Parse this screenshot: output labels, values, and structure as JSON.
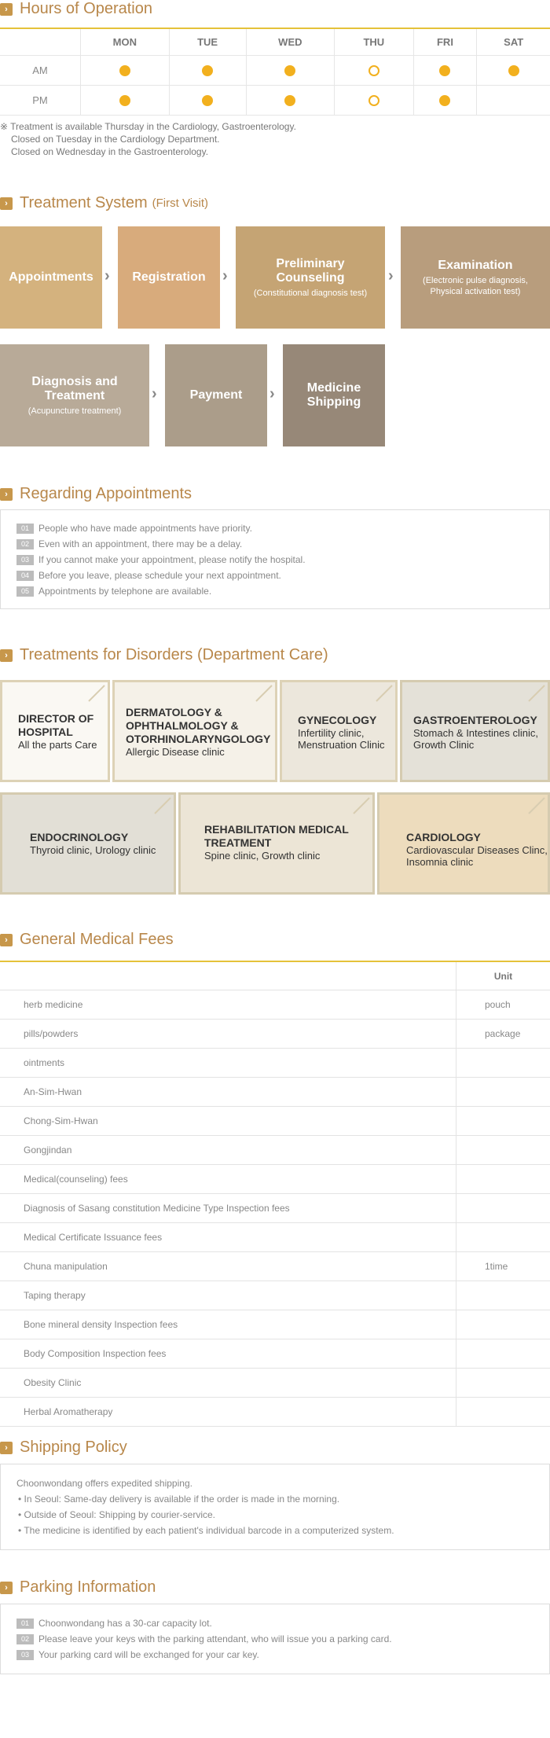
{
  "hours": {
    "title": "Hours of Operation",
    "days": [
      "MON",
      "TUE",
      "WED",
      "THU",
      "FRI",
      "SAT"
    ],
    "rows": [
      {
        "label": "AM",
        "cells": [
          "filled",
          "filled",
          "filled",
          "open",
          "filled",
          "filled"
        ]
      },
      {
        "label": "PM",
        "cells": [
          "filled",
          "filled",
          "filled",
          "open",
          "filled",
          "none"
        ]
      }
    ],
    "notes": [
      "※ Treatment is available Thursday in the Cardiology, Gastroenterology.",
      "Closed on Tuesday in the Cardiology Department.",
      "Closed on Wednesday in the Gastroenterology."
    ]
  },
  "treatment_system": {
    "title": "Treatment System",
    "subtitle": "(First Visit)",
    "steps": [
      {
        "title": "Appointments",
        "sub": ""
      },
      {
        "title": "Registration",
        "sub": ""
      },
      {
        "title": "Preliminary Counseling",
        "sub": "(Constitutional diagnosis test)"
      },
      {
        "title": "Examination",
        "sub": "(Electronic pulse diagnosis, Physical activation test)"
      },
      {
        "title": "Diagnosis and Treatment",
        "sub": "(Acupuncture treatment)"
      },
      {
        "title": "Payment",
        "sub": ""
      },
      {
        "title": "Medicine Shipping",
        "sub": ""
      }
    ]
  },
  "appointments": {
    "title": "Regarding Appointments",
    "items": [
      {
        "num": "01",
        "text": "People who have made appointments have priority."
      },
      {
        "num": "02",
        "text": "Even with an appointment, there may be a delay."
      },
      {
        "num": "03",
        "text": "If you cannot make your appointment, please notify the hospital."
      },
      {
        "num": "04",
        "text": "Before you leave, please schedule your next appointment."
      },
      {
        "num": "05",
        "text": "Appointments by telephone are available."
      }
    ]
  },
  "disorders": {
    "title": "Treatments for Disorders (Department Care)",
    "departments": [
      {
        "name": "DIRECTOR OF HOSPITAL",
        "desc": "All the parts Care"
      },
      {
        "name": "DERMATOLOGY & OPHTHALMOLOGY & OTORHINOLARYNGOLOGY",
        "desc": "Allergic Disease clinic"
      },
      {
        "name": "GYNECOLOGY",
        "desc": "Infertility clinic, Menstruation Clinic"
      },
      {
        "name": "GASTROENTEROLOGY",
        "desc": "Stomach & Intestines clinic, Growth Clinic"
      },
      {
        "name": "ENDOCRINOLOGY",
        "desc": "Thyroid clinic, Urology clinic"
      },
      {
        "name": "REHABILITATION MEDICAL TREATMENT",
        "desc": "Spine clinic, Growth clinic"
      },
      {
        "name": "CARDIOLOGY",
        "desc": "Cardiovascular Diseases Clinc, Insomnia clinic"
      }
    ]
  },
  "fees": {
    "title": "General Medical Fees",
    "unit_header": "Unit",
    "rows": [
      {
        "item": "herb medicine",
        "unit": "pouch"
      },
      {
        "item": "pills/powders",
        "unit": "package"
      },
      {
        "item": "ointments",
        "unit": ""
      },
      {
        "item": "An-Sim-Hwan",
        "unit": ""
      },
      {
        "item": "Chong-Sim-Hwan",
        "unit": ""
      },
      {
        "item": "Gongjindan",
        "unit": ""
      },
      {
        "item": "Medical(counseling) fees",
        "unit": ""
      },
      {
        "item": "Diagnosis of Sasang constitution Medicine Type Inspection fees",
        "unit": ""
      },
      {
        "item": "Medical Certificate Issuance fees",
        "unit": ""
      },
      {
        "item": "Chuna manipulation",
        "unit": "1time"
      },
      {
        "item": "Taping therapy",
        "unit": ""
      },
      {
        "item": "Bone mineral density Inspection fees",
        "unit": ""
      },
      {
        "item": "Body Composition Inspection fees",
        "unit": ""
      },
      {
        "item": "Obesity Clinic",
        "unit": ""
      },
      {
        "item": "Herbal Aromatherapy",
        "unit": ""
      }
    ]
  },
  "shipping": {
    "title": "Shipping Policy",
    "intro": "Choonwondang offers expedited shipping.",
    "items": [
      "• In Seoul: Same-day delivery is available if the order is made in the morning.",
      "• Outside of Seoul: Shipping by courier-service.",
      "• The medicine is identified by each patient's individual barcode in a computerized system."
    ]
  },
  "parking": {
    "title": "Parking Information",
    "items": [
      {
        "num": "01",
        "text": "Choonwondang has a 30-car capacity lot."
      },
      {
        "num": "02",
        "text": "Please leave your keys with the parking attendant, who will issue you a parking card."
      },
      {
        "num": "03",
        "text": "Your parking card will be exchanged for your car key."
      }
    ]
  }
}
